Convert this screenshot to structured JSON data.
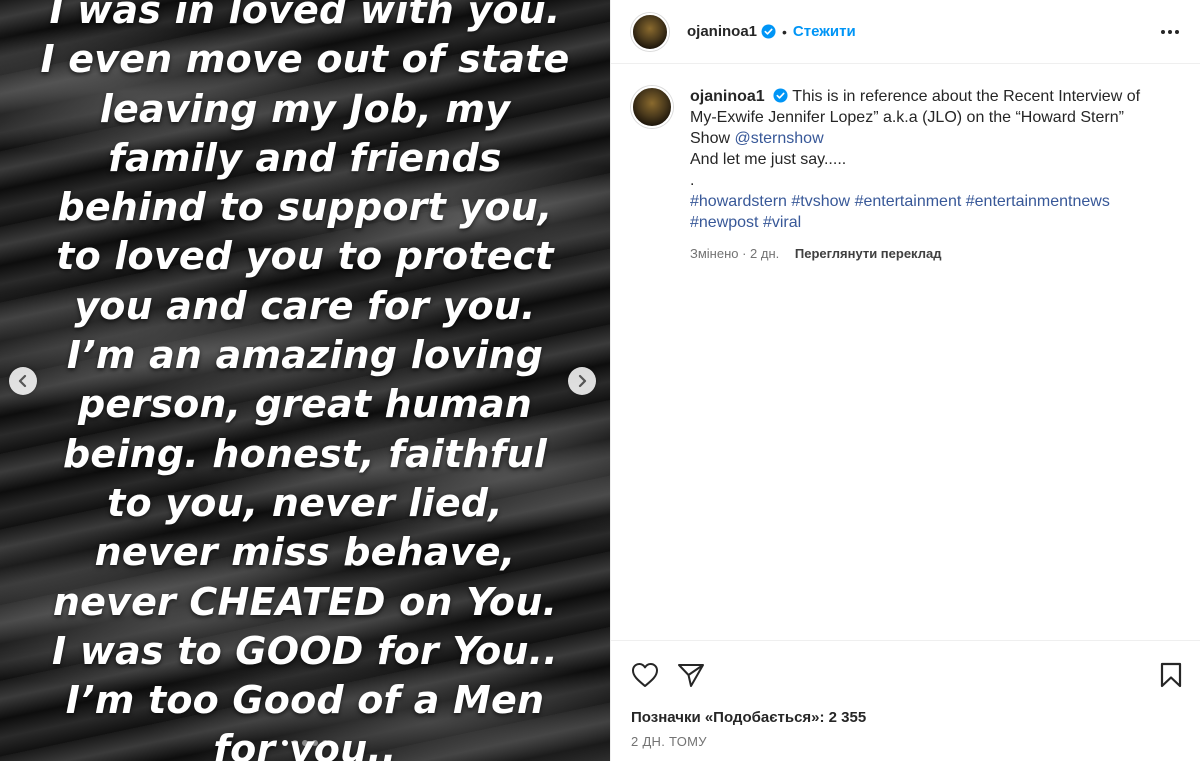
{
  "post": {
    "media_text_lines": [
      "I was in loved with you.",
      "I even move out of state",
      "leaving my Job, my",
      "family and friends",
      "behind to support you,",
      "to loved you to protect",
      "you and care for you.",
      "I’m an amazing loving",
      "person, great human",
      "being. honest, faithful",
      "to you, never lied,",
      "never miss behave,",
      "never CHEATED on You.",
      "I was to GOOD for You..",
      "I’m too Good of a Men",
      "for you.."
    ]
  },
  "header": {
    "username": "ojaninoa1",
    "separator": "•",
    "follow_label": "Стежити"
  },
  "caption": {
    "username": "ojaninoa1",
    "text_line1": "This is in reference about the Recent Interview of My-Exwife Jennifer Lopez” a.k.a (JLO) on the “Howard Stern” Show ",
    "mention": "@sternshow",
    "text_line2": "And let me just say.....",
    "text_line3": ".",
    "hashtags": [
      "#howardstern",
      "#tvshow",
      "#entertainment",
      "#entertainmentnews",
      "#newpost",
      "#viral"
    ],
    "edited_label": "Змінено · 2 дн.",
    "translate_label": "Переглянути переклад"
  },
  "actions": {
    "likes_label": "Позначки «Подобається»: 2 355",
    "date_label": "2 ДН. ТОМУ"
  },
  "colors": {
    "accent": "#0095f6",
    "link": "#385898",
    "text": "#262626",
    "muted": "#737373"
  }
}
